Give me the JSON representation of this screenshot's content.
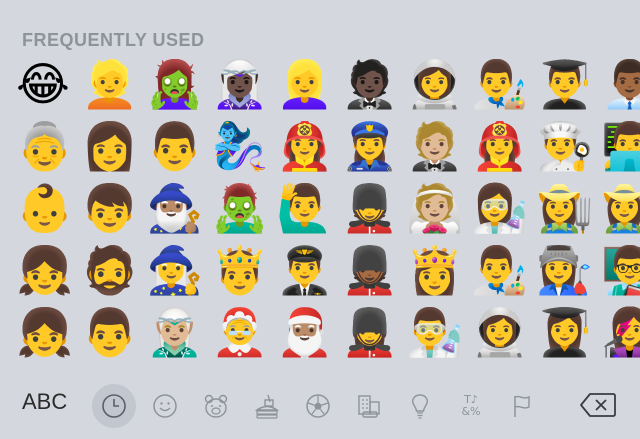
{
  "section_title": "FREQUENTLY USED",
  "emojis": [
    "😂",
    "👱",
    "🧟‍♀️",
    "🧝🏿‍♀️",
    "👱‍♀️",
    "🤵🏿",
    "👩‍🚀",
    "👨‍🎨",
    "👨‍🎓",
    "👨🏾‍💼",
    "👵",
    "👩",
    "👨",
    "🧞‍♀️",
    "👩‍🚒",
    "👮‍♀️",
    "🤵🏼",
    "👩‍🚒",
    "👨‍🍳",
    "👨‍💻",
    "👶",
    "👦",
    "🧙🏽‍♂️",
    "🧟‍♂️",
    "🙋‍♂️",
    "💂",
    "👰🏼",
    "👩‍🔬",
    "👩‍🌾",
    "👩‍🌾",
    "👧",
    "🧔",
    "🧙‍♀️",
    "🤴",
    "👨‍✈️",
    "💂🏾",
    "👸",
    "👨‍🎨",
    "👩‍🏭",
    "👨‍🏫",
    "👧",
    "👨",
    "🧝🏼‍♂️",
    "🤶",
    "🎅🏽",
    "💂‍♀️",
    "👨‍🔬",
    "👩‍🚀",
    "👩‍🎓",
    "👩‍🎤"
  ],
  "bottom": {
    "abc_label": "ABC",
    "categories": [
      {
        "icon": "recent-clock-icon"
      },
      {
        "icon": "smiley-icon"
      },
      {
        "icon": "animal-bear-icon"
      },
      {
        "icon": "food-burger-icon"
      },
      {
        "icon": "sports-ball-icon"
      },
      {
        "icon": "travel-building-icon"
      },
      {
        "icon": "objects-lightbulb-icon"
      },
      {
        "icon": "symbols-icon"
      },
      {
        "icon": "flag-icon"
      }
    ],
    "symbols_text_top": "T♪",
    "symbols_text_bottom": "&%"
  }
}
